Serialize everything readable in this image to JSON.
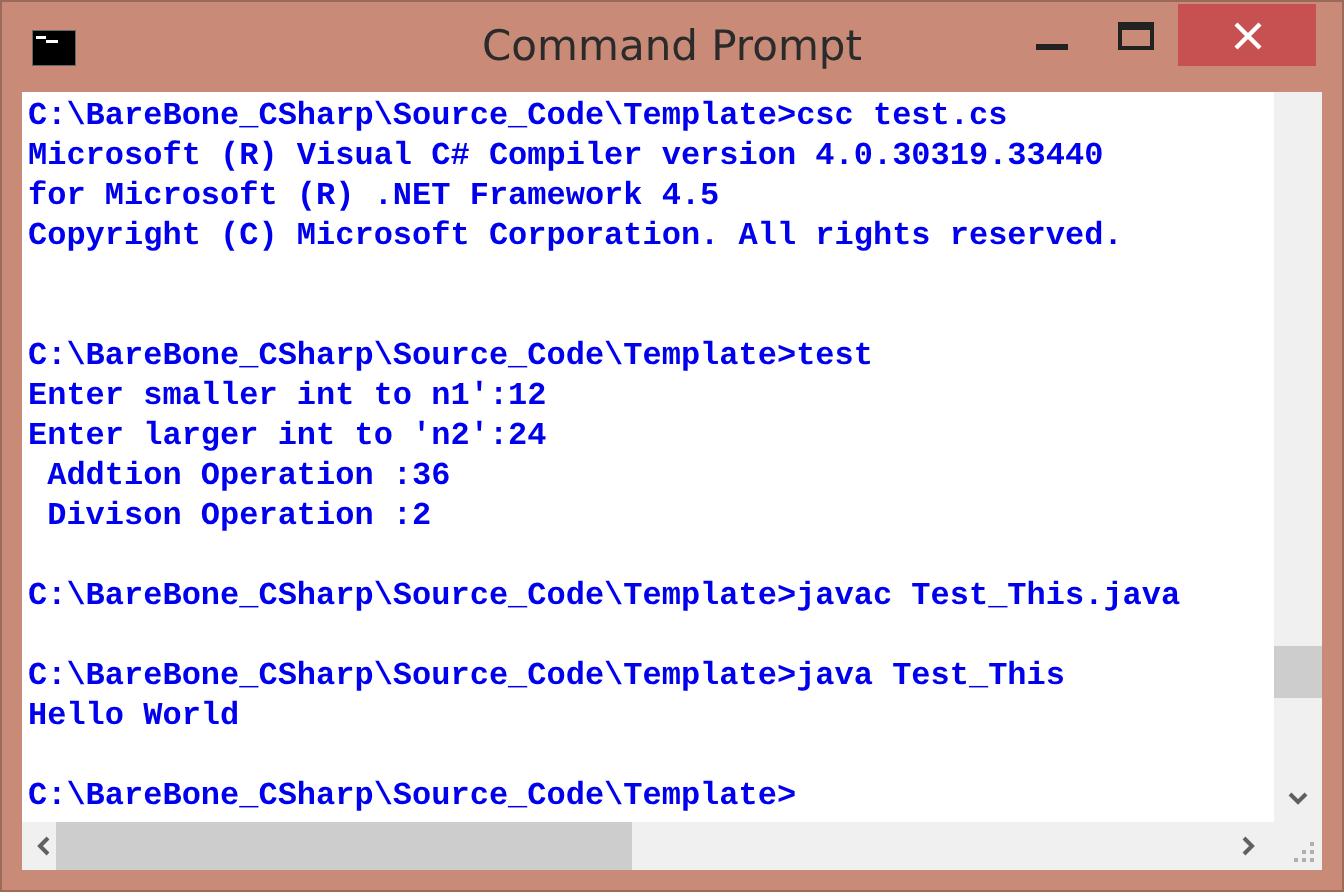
{
  "window": {
    "title": "Command Prompt"
  },
  "console": {
    "lines": [
      {
        "kind": "text",
        "text": "C:\\BareBone_CSharp\\Source_Code\\Template>csc test.cs"
      },
      {
        "kind": "text",
        "text": "Microsoft (R) Visual C# Compiler version 4.0.30319.33440"
      },
      {
        "kind": "text",
        "text": "for Microsoft (R) .NET Framework 4.5"
      },
      {
        "kind": "text",
        "text": "Copyright (C) Microsoft Corporation. All rights reserved."
      },
      {
        "kind": "blank"
      },
      {
        "kind": "blank"
      },
      {
        "kind": "text",
        "text": "C:\\BareBone_CSharp\\Source_Code\\Template>test"
      },
      {
        "kind": "text",
        "text": "Enter smaller int to n1':12"
      },
      {
        "kind": "text",
        "text": "Enter larger int to 'n2':24"
      },
      {
        "kind": "text",
        "text": " Addtion Operation :36"
      },
      {
        "kind": "text",
        "text": " Divison Operation :2"
      },
      {
        "kind": "blank"
      },
      {
        "kind": "text",
        "text": "C:\\BareBone_CSharp\\Source_Code\\Template>javac Test_This.java"
      },
      {
        "kind": "blank"
      },
      {
        "kind": "text",
        "text": "C:\\BareBone_CSharp\\Source_Code\\Template>java Test_This"
      },
      {
        "kind": "text",
        "text": "Hello World"
      },
      {
        "kind": "blank"
      },
      {
        "kind": "text",
        "text": "C:\\BareBone_CSharp\\Source_Code\\Template>"
      }
    ]
  }
}
